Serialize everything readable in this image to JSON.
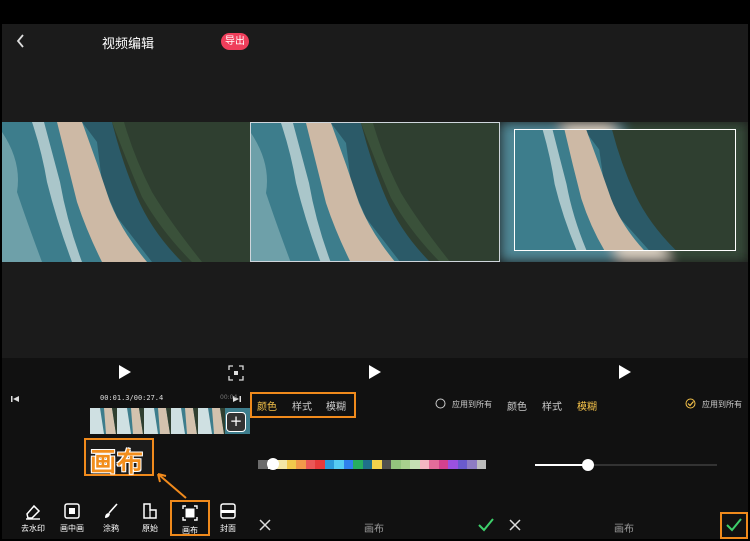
{
  "header": {
    "title": "视频编辑",
    "export_label": "导出"
  },
  "player": {
    "current_time": "00:01.3",
    "total_time": "/00:27.4",
    "marker_time": "00:04"
  },
  "callout_label": "画布",
  "toolbar": {
    "items": [
      {
        "label": "去水印",
        "icon": "eraser-icon"
      },
      {
        "label": "画中画",
        "icon": "picture-in-picture-icon"
      },
      {
        "label": "涂鸦",
        "icon": "brush-icon"
      },
      {
        "label": "原始",
        "icon": "original-icon"
      },
      {
        "label": "画布",
        "icon": "canvas-icon",
        "active": true
      },
      {
        "label": "封面",
        "icon": "cover-icon"
      }
    ]
  },
  "canvas_panel_colors": {
    "tabs": [
      "颜色",
      "样式",
      "模糊"
    ],
    "active_tab": "颜色",
    "bottom_label": "画布",
    "palette": [
      "#6b6b6b",
      "#ffffff",
      "#f3e6a5",
      "#f2c94c",
      "#f2994a",
      "#eb5757",
      "#e83b3b",
      "#2d9cdb",
      "#56ccf2",
      "#2f80ed",
      "#27ae60",
      "#1f6f8b",
      "#f2d24b",
      "#4f4f4f",
      "#93c47d",
      "#a8d08d",
      "#c6e0b4",
      "#f4b6c2",
      "#e36c9a",
      "#d4418e",
      "#9b51e0",
      "#6a5acd",
      "#8e7cc3",
      "#bdbdbd"
    ]
  },
  "canvas_panel_blur": {
    "apply_all": "应用到所有",
    "tabs": [
      "颜色",
      "样式",
      "模糊"
    ],
    "active_tab": "模糊",
    "bottom_label": "画布",
    "blur_level": 0.29
  },
  "apply_all_right": "应用到所有",
  "accent": "#f08a1c",
  "tab_active_color": "#f6c34a",
  "export_color": "#ef3e5b",
  "confirm_color": "#3ecf6b"
}
